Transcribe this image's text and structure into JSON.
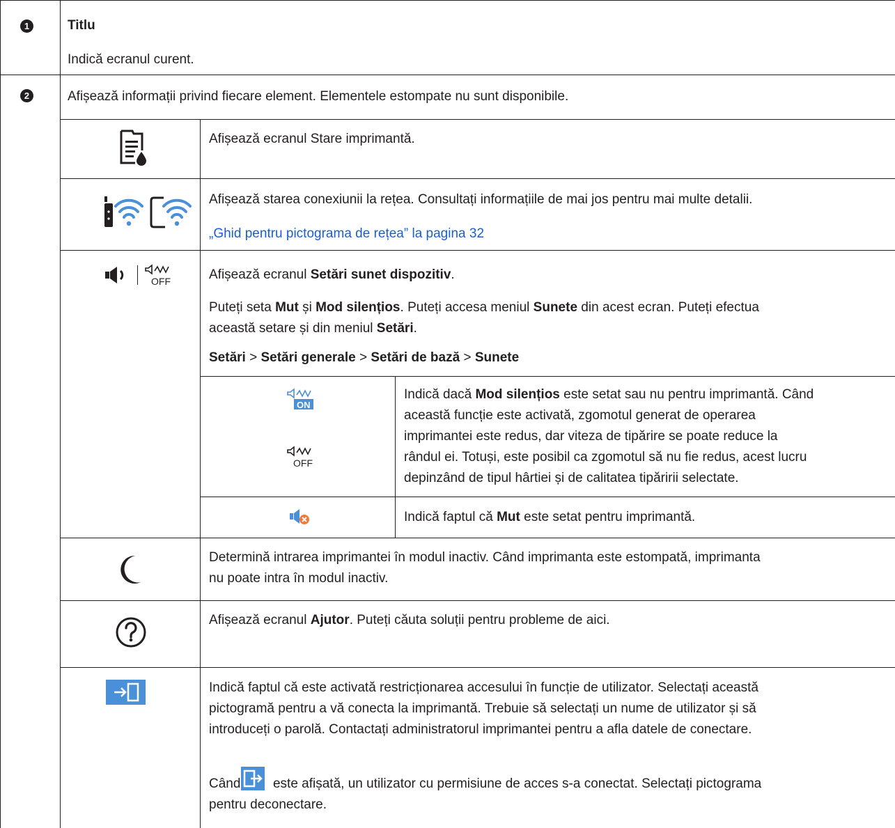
{
  "row1": {
    "number": "1",
    "title": "Titlu",
    "desc": "Indică ecranul curent."
  },
  "row2": {
    "number": "2",
    "intro": "Afișează informații privind fiecare element. Elementele estompate nu sunt disponibile.",
    "printer_status": {
      "icon": "printer-status-icon",
      "text": "Afișează ecranul Stare imprimantă."
    },
    "network": {
      "icons": [
        "router-wifi-icon",
        "device-wifi-icon"
      ],
      "text": "Afișează starea conexiunii la rețea. Consultați informațiile de mai jos pentru mai multe detalii.",
      "link": "„Ghid pentru pictograma de rețea” la pagina 32"
    },
    "sound": {
      "icons": [
        "speaker-icon",
        "silent-mode-off-icon"
      ],
      "line1_pre": "Afișează ecranul ",
      "line1_bold": "Setări sunet dispozitiv",
      "line1_post": ".",
      "p2_a": "Puteți seta ",
      "p2_b": "Mut",
      "p2_c": " și ",
      "p2_d": "Mod silențios",
      "p2_e": ". Puteți accesa meniul ",
      "p2_f": "Sunete",
      "p2_g": " din acest ecran. Puteți efectua",
      "p2_h": "această setare și din meniul ",
      "p2_i": "Setări",
      "p2_j": ".",
      "path": [
        "Setări",
        "Setări generale",
        "Setări de bază",
        "Sunete"
      ],
      "path_sep": " > ",
      "silent": {
        "icons": [
          "silent-mode-on-icon",
          "silent-mode-off-icon"
        ],
        "on_label": "ON",
        "off_label": "OFF",
        "l1_pre": "Indică dacă ",
        "l1_bold": "Mod silențios",
        "l1_post": " este setat sau nu pentru imprimantă. Când",
        "l2": "această funcție este activată, zgomotul generat de operarea",
        "l3": "imprimantei este redus, dar viteza de tipărire se poate reduce la",
        "l4": "rândul ei. Totuși, este posibil ca zgomotul să nu fie redus, acest lucru",
        "l5": "depinzând de tipul hârtiei și de calitatea tipăririi selectate."
      },
      "mute": {
        "icon": "mute-icon",
        "pre": "Indică faptul că ",
        "bold": "Mut",
        "post": " este setat pentru imprimantă."
      }
    },
    "sleep": {
      "icon": "moon-icon",
      "l1": "Determină intrarea imprimantei în modul inactiv. Când imprimanta este estompată, imprimanta",
      "l2": "nu poate intra în modul inactiv."
    },
    "help": {
      "icon": "help-icon",
      "pre": "Afișează ecranul ",
      "bold": "Ajutor",
      "post": ". Puteți căuta soluții pentru probleme de aici."
    },
    "login": {
      "icon": "login-icon",
      "l1": "Indică faptul că este activată restricționarea accesului în funcție de utilizator. Selectați această",
      "l2": "pictogramă pentru a vă conecta la imprimantă. Trebuie să selectați un nume de utilizator și să",
      "l3": "introduceți o parolă. Contactați administratorul imprimantei pentru a afla datele de conectare.",
      "l4_pre": "Când ",
      "l4_icon": "logout-icon",
      "l4_post": " este afișată, un utilizator cu permisiune de acces s-a conectat. Selectați pictograma",
      "l5": "pentru deconectare."
    }
  },
  "colors": {
    "text": "#231f20",
    "link": "#1a5fd0",
    "icon_blue": "#4a90d9",
    "badge_orange": "#f07a3a"
  }
}
